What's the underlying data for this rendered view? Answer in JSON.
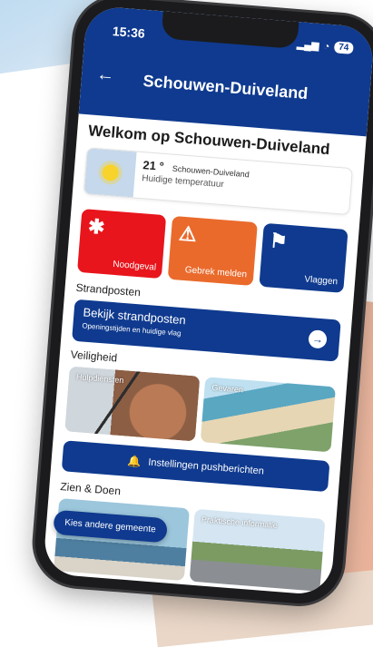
{
  "status_bar": {
    "time": "15:36",
    "battery": "74"
  },
  "app_bar": {
    "back_glyph": "←",
    "title": "Schouwen-Duiveland"
  },
  "welcome": {
    "heading": "Welkom op Schouwen-Duiveland"
  },
  "weather": {
    "icon": "sun-icon",
    "temperature": "21 °",
    "location": "Schouwen-Duiveland",
    "caption": "Huidige temperatuur"
  },
  "tiles": [
    {
      "label": "Noodgeval",
      "icon": "asterisk-icon",
      "glyph": "✱",
      "color": "#e8151c"
    },
    {
      "label": "Gebrek melden",
      "icon": "warning-icon",
      "glyph": "⚠",
      "color": "#ea6a2c"
    },
    {
      "label": "Vlaggen",
      "icon": "flag-icon",
      "glyph": "⚑",
      "color": "#0f3a8f"
    }
  ],
  "strandposten": {
    "section_title": "Strandposten",
    "card_title": "Bekijk strandposten",
    "card_subtitle": "Openingstijden en huidige vlag",
    "arrow_glyph": "→"
  },
  "veiligheid": {
    "section_title": "Veiligheid",
    "cards": [
      {
        "label": "Hulpdiensten"
      },
      {
        "label": "Gevaren"
      }
    ]
  },
  "push": {
    "bell_glyph": "🔔",
    "label": "Instellingen pushberichten"
  },
  "zien_doen": {
    "section_title": "Zien & Doen",
    "cards": [
      {
        "label": ""
      },
      {
        "label": "Praktische informatie"
      }
    ]
  },
  "floating_chip": {
    "label": "Kies andere gemeente"
  },
  "colors": {
    "primary": "#0f3a8f",
    "danger": "#e8151c",
    "warning": "#ea6a2c"
  }
}
